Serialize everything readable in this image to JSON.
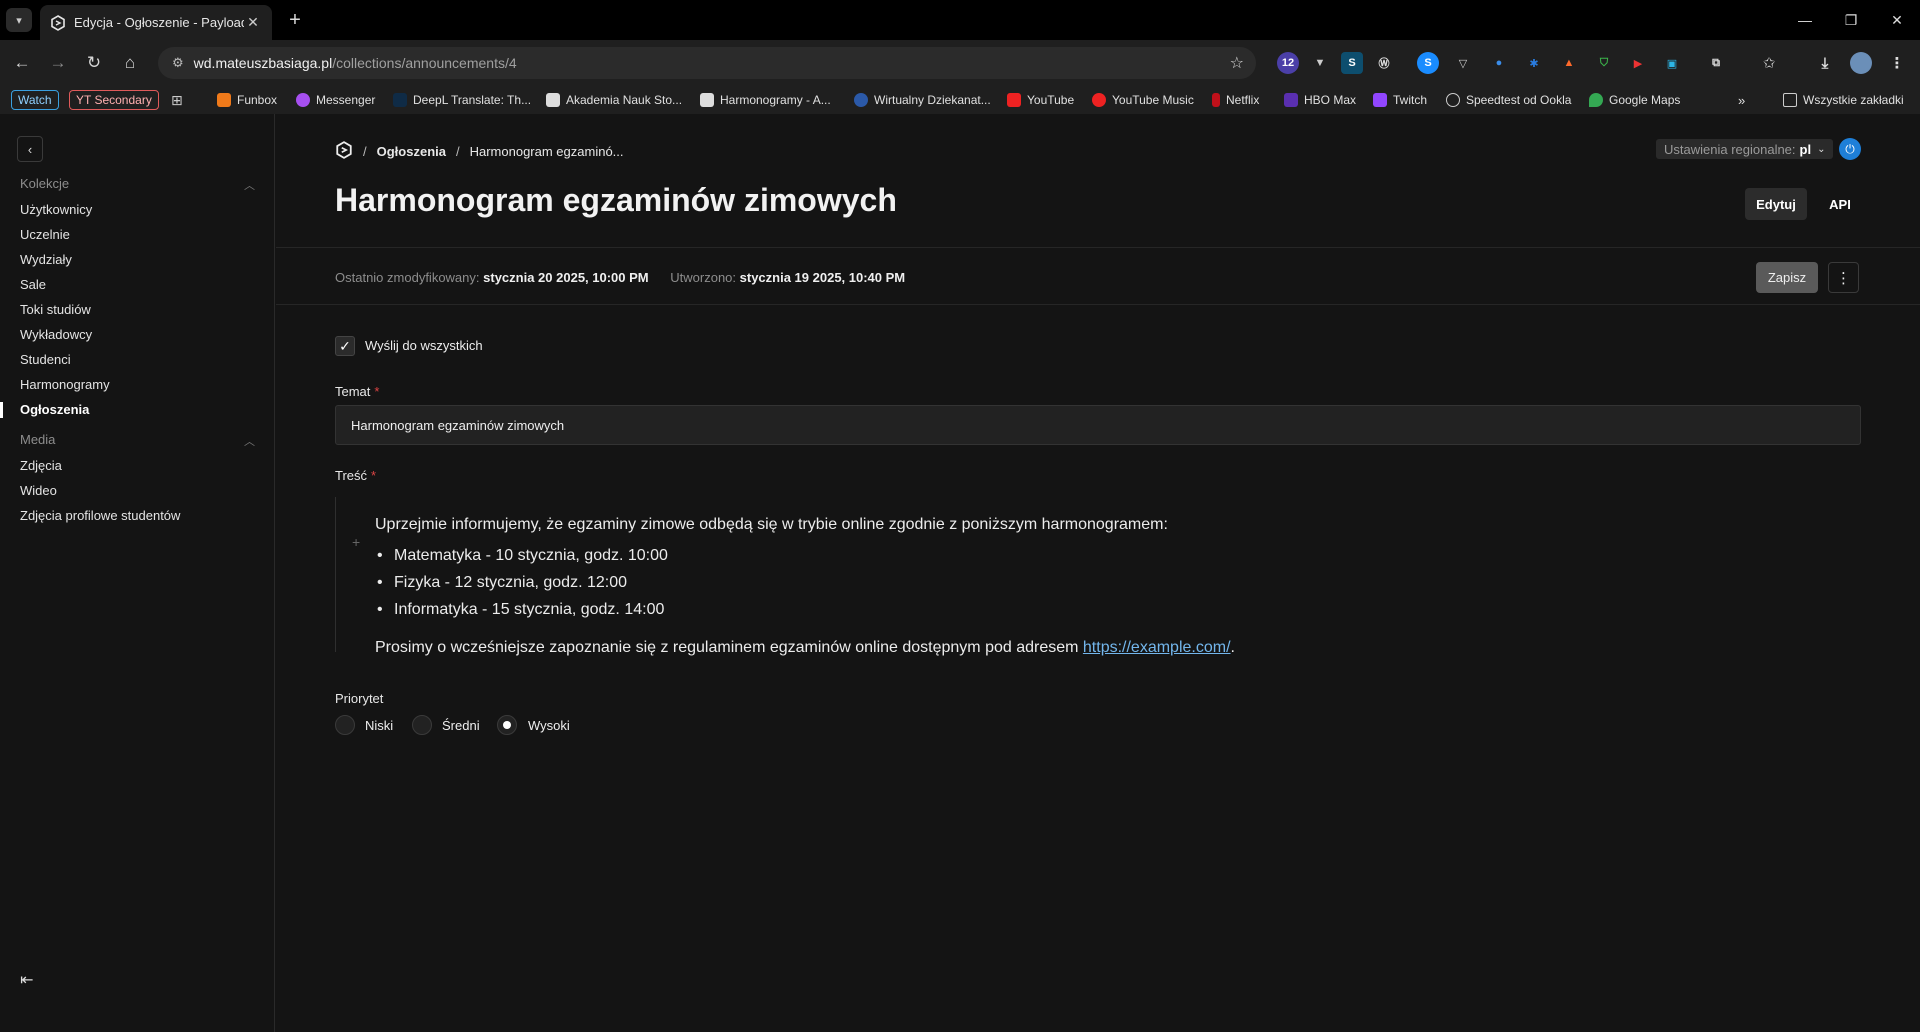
{
  "browser": {
    "tab_title": "Edycja - Ogłoszenie - Payload",
    "url_host": "wd.mateuszbasiaga.pl",
    "url_path": "/collections/announcements/4",
    "extension_badge": "12",
    "bookmarks": {
      "pill1": "Watch",
      "pill2": "YT Secondary",
      "items": [
        "Funbox",
        "Messenger",
        "DeepL Translate: Th...",
        "Akademia Nauk Sto...",
        "Harmonogramy - A...",
        "Wirtualny Dziekanat...",
        "YouTube",
        "YouTube Music",
        "Netflix",
        "HBO Max",
        "Twitch",
        "Speedtest od Ookla",
        "Google Maps"
      ],
      "all_bookmarks": "Wszystkie zakładki"
    }
  },
  "sidebar": {
    "group1": "Kolekcje",
    "group1_items": [
      "Użytkownicy",
      "Uczelnie",
      "Wydziały",
      "Sale",
      "Toki studiów",
      "Wykładowcy",
      "Studenci",
      "Harmonogramy",
      "Ogłoszenia"
    ],
    "group2": "Media",
    "group2_items": [
      "Zdjęcia",
      "Wideo",
      "Zdjęcia profilowe studentów"
    ]
  },
  "header": {
    "crumb1": "Ogłoszenia",
    "crumb2": "Harmonogram egzaminó...",
    "locale_label": "Ustawienia regionalne:",
    "locale_value": "pl",
    "title": "Harmonogram egzaminów zimowych",
    "edit_tab": "Edytuj",
    "api_tab": "API"
  },
  "meta": {
    "modified_label": "Ostatnio zmodyfikowany:",
    "modified_value": "stycznia 20 2025, 10:00 PM",
    "created_label": "Utworzono:",
    "created_value": "stycznia 19 2025, 10:40 PM",
    "save": "Zapisz"
  },
  "form": {
    "send_all_label": "Wyślij do wszystkich",
    "send_all_checked": true,
    "subject_label": "Temat",
    "subject_value": "Harmonogram egzaminów zimowych",
    "content_label": "Treść",
    "content_intro": "Uprzejmie informujemy, że egzaminy zimowe odbędą się w trybie online zgodnie z poniższym harmonogramem:",
    "content_items": [
      "Matematyka - 10 stycznia, godz. 10:00",
      "Fizyka - 12 stycznia, godz. 12:00",
      "Informatyka - 15 stycznia, godz. 14:00"
    ],
    "content_outro": "Prosimy o wcześniejsze zapoznanie się z regulaminem egzaminów online dostępnym pod adresem ",
    "content_link": "https://example.com/",
    "content_end": ".",
    "required_mark": "*",
    "priority_label": "Priorytet",
    "priority_options": [
      "Niski",
      "Średni",
      "Wysoki"
    ],
    "priority_selected": "Wysoki"
  }
}
